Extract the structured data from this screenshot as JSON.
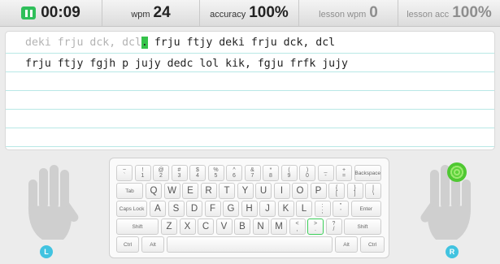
{
  "stats": {
    "timer": "00:09",
    "wpm_label": "wpm",
    "wpm_value": "24",
    "accuracy_label": "accuracy",
    "accuracy_value": "100%",
    "lesson_wpm_label": "lesson wpm",
    "lesson_wpm_value": "0",
    "lesson_acc_label": "lesson acc",
    "lesson_acc_value": "100%"
  },
  "lesson": {
    "line1_typed": "deki frju dck, dcl",
    "line1_current": ".",
    "line1_rest": " frju ftjy deki frju dck, dcl",
    "line2": "frju ftjy fgjh p jujy dedc lol kik, fgju frfk jujy"
  },
  "keyboard": {
    "row0": [
      {
        "top": "~",
        "bottom": "`"
      },
      {
        "top": "!",
        "bottom": "1"
      },
      {
        "top": "@",
        "bottom": "2"
      },
      {
        "top": "#",
        "bottom": "3"
      },
      {
        "top": "$",
        "bottom": "4"
      },
      {
        "top": "%",
        "bottom": "5"
      },
      {
        "top": "^",
        "bottom": "6"
      },
      {
        "top": "&",
        "bottom": "7"
      },
      {
        "top": "*",
        "bottom": "8"
      },
      {
        "top": "(",
        "bottom": "9"
      },
      {
        "top": ")",
        "bottom": "0"
      },
      {
        "top": "_",
        "bottom": "-"
      },
      {
        "top": "+",
        "bottom": "="
      }
    ],
    "backspace": "Backspace",
    "tab": "Tab",
    "row1": [
      "Q",
      "W",
      "E",
      "R",
      "T",
      "Y",
      "U",
      "I",
      "O",
      "P"
    ],
    "row1_sym": [
      {
        "top": "{",
        "bottom": "["
      },
      {
        "top": "}",
        "bottom": "]"
      },
      {
        "top": "|",
        "bottom": "\\"
      }
    ],
    "caps": "Caps Lock",
    "row2": [
      "A",
      "S",
      "D",
      "F",
      "G",
      "H",
      "J",
      "K",
      "L"
    ],
    "row2_sym": [
      {
        "top": ":",
        "bottom": ";"
      },
      {
        "top": "\"",
        "bottom": "'"
      }
    ],
    "enter": "Enter",
    "shift_left": "Shift",
    "row3": [
      "Z",
      "X",
      "C",
      "V",
      "B",
      "N",
      "M"
    ],
    "row3_sym": [
      {
        "top": "<",
        "bottom": ","
      },
      {
        "top": ">",
        "bottom": "."
      },
      {
        "top": "?",
        "bottom": "/"
      }
    ],
    "shift_right": "Shift",
    "ctrl_left": "Ctrl",
    "alt_left": "Alt",
    "alt_right": "Alt",
    "ctrl_right": "Ctrl",
    "next_key": "."
  },
  "hands": {
    "left_label": "L",
    "right_label": "R"
  },
  "colors": {
    "accent_green": "#35c34a",
    "hand_badge": "#41c3e0",
    "line_rule": "#b8e8e6"
  }
}
